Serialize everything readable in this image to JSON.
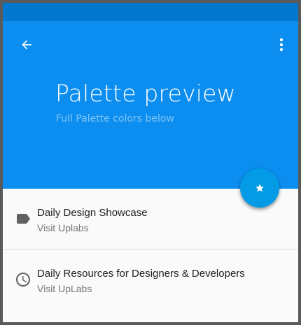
{
  "colors": {
    "status_bar": "#0277cf",
    "primary": "#0b8ef0",
    "fab": "#039be5",
    "title_text": "#ffffff",
    "subtitle_text": "#7fc4f7"
  },
  "toolbar": {
    "back_icon": "arrow-back-icon",
    "menu_icon": "more-vert-icon"
  },
  "hero": {
    "title": "Palette preview",
    "subtitle": "Full Palette colors below"
  },
  "fab": {
    "icon": "star-icon"
  },
  "list": {
    "items": [
      {
        "icon": "label-icon",
        "primary": "Daily Design Showcase",
        "secondary": "Visit Uplabs"
      },
      {
        "icon": "clock-icon",
        "primary": "Daily Resources for Designers & Developers",
        "secondary": "Visit UpLabs"
      }
    ]
  }
}
